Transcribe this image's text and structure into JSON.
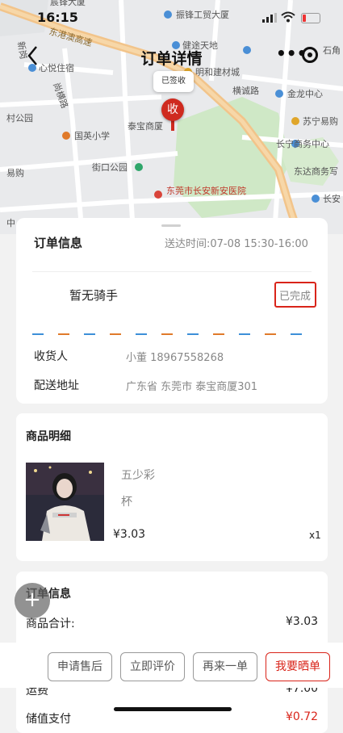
{
  "status_bar": {
    "time": "16:15"
  },
  "nav": {
    "title": "订单详情"
  },
  "map": {
    "signed_label": "已签收",
    "receive_marker": "收",
    "labels": [
      "宸锋大厦",
      "振锋工贸大厦",
      "东港澳高速",
      "新岗",
      "健途天地",
      "心悦住宿",
      "明和建材城",
      "石角",
      "横诚路",
      "尚横路",
      "金龙中心",
      "村公园",
      "国英小学",
      "泰宝商厦",
      "苏宁易购",
      "长宁商务中心",
      "易购",
      "街口公园",
      "东达商务写",
      "东莞市长安新安医院",
      "长安",
      "中"
    ]
  },
  "delivery": {
    "title": "订单信息",
    "time": "送达时间:07-08 15:30-16:00",
    "rider": "暂无骑手",
    "status": "已完成",
    "receiver_label": "收货人",
    "receiver_value": "小董 18967558268",
    "address_label": "配送地址",
    "address_value": "广东省 东莞市 泰宝商厦301"
  },
  "goods": {
    "title": "商品明细",
    "item_name": "五少彩",
    "item_spec": "杯",
    "item_price": "¥3.03",
    "item_qty": "x1"
  },
  "order": {
    "title": "订单信息",
    "subtotal_label": "商品合计:",
    "subtotal_value": "¥3.03",
    "freight_label": "运费",
    "freight_value": "¥7.00",
    "stored_label": "储值支付",
    "stored_value": "¥0.72"
  },
  "actions": {
    "after_sale": "申请售后",
    "review": "立即评价",
    "reorder": "再来一单",
    "show": "我要晒单"
  },
  "fab": "+",
  "colors": {
    "accent_red": "#d9241a",
    "dash_blue": "#3d8fd8",
    "dash_orange": "#e07a2a"
  }
}
